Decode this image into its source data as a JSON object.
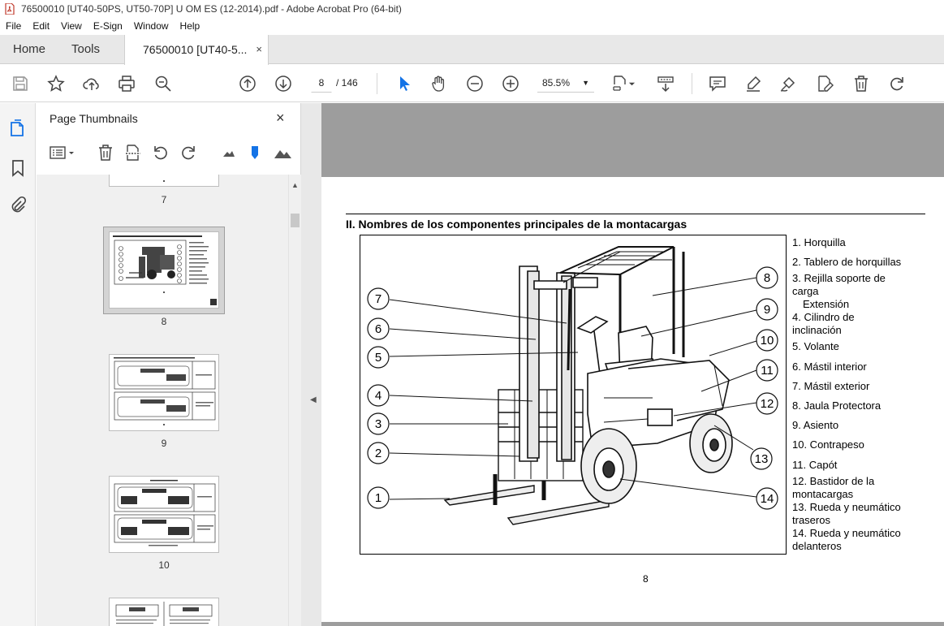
{
  "window": {
    "title": "76500010 [UT40-50PS, UT50-70P] U OM ES (12-2014).pdf - Adobe Acrobat Pro (64-bit)"
  },
  "menu": [
    "File",
    "Edit",
    "View",
    "E-Sign",
    "Window",
    "Help"
  ],
  "tabs": {
    "home": "Home",
    "tools": "Tools",
    "document": "76500010 [UT40-5...",
    "close": "×"
  },
  "toolbar": {
    "current_page": "8",
    "total_pages": "/ 146",
    "zoom": "85.5%"
  },
  "thumbnails_panel": {
    "title": "Page Thumbnails",
    "close": "×",
    "pages": [
      {
        "label": "7"
      },
      {
        "label": "8",
        "selected": true
      },
      {
        "label": "9"
      },
      {
        "label": "10"
      }
    ]
  },
  "document": {
    "heading": "II. Nombres de los componentes principales de la montacargas",
    "page_number": "8",
    "callouts": [
      "1",
      "2",
      "3",
      "4",
      "5",
      "6",
      "7",
      "8",
      "9",
      "10",
      "11",
      "12",
      "13",
      "14"
    ],
    "parts": [
      "1. Horquilla",
      "2. Tablero de horquillas",
      "3. Rejilla soporte de",
      "carga",
      "Extensión",
      "4. Cilindro de",
      "inclinación",
      "5. Volante",
      "6. Mástil interior",
      "7. Mástil exterior",
      "8. Jaula Protectora",
      "9. Asiento",
      "10. Contrapeso",
      "11. Capót",
      "12. Bastidor de la",
      "montacargas",
      "13. Rueda y neumático",
      "traseros",
      "14. Rueda y neumático",
      "delanteros"
    ]
  },
  "colors": {
    "accent": "#1473e6",
    "doc_background": "#9d9d9d"
  }
}
